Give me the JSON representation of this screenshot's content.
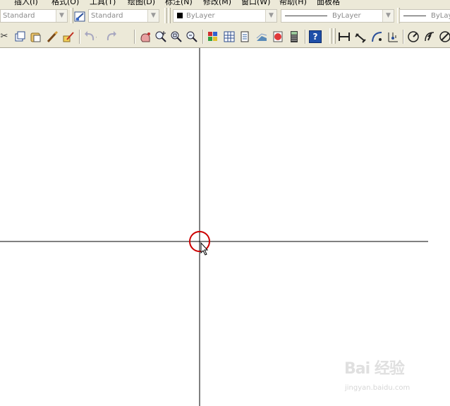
{
  "menubar": {
    "items": [
      "插入(I)",
      "格式(O)",
      "工具(T)",
      "绘图(D)",
      "标注(N)",
      "修改(M)",
      "窗口(W)",
      "帮助(H)",
      "面板格"
    ]
  },
  "toolbar_styles": {
    "text_style": "Standard",
    "dim_style": "Standard",
    "color": "ByLayer",
    "linetype": "ByLayer",
    "lineweight": "ByLay"
  },
  "toolbar_standard": {
    "tools": [
      "cut-icon",
      "copy-icon",
      "paste-icon",
      "match-properties-icon",
      "block-editor-icon",
      "undo-icon",
      "redo-icon",
      "pan-icon",
      "zoom-realtime-icon",
      "zoom-window-icon",
      "zoom-previous-icon",
      "properties-icon",
      "design-center-icon",
      "tool-palettes-icon",
      "sheet-set-icon",
      "markup-icon",
      "calculator-icon",
      "help-icon"
    ]
  },
  "toolbar_dimension": {
    "tools": [
      "linear-dim-icon",
      "aligned-dim-icon",
      "arc-length-icon",
      "ordinate-dim-icon",
      "radius-dim-icon",
      "jogged-dim-icon",
      "diameter-dim-icon"
    ]
  },
  "colors": {
    "toolbar_bg": "#ece9d8",
    "canvas_bg": "#ffffff",
    "crosshair": "#000000",
    "pick_circle": "#cc0000"
  },
  "watermark": {
    "brand": "Bai 经验",
    "url": "jingyan.baidu.com"
  }
}
